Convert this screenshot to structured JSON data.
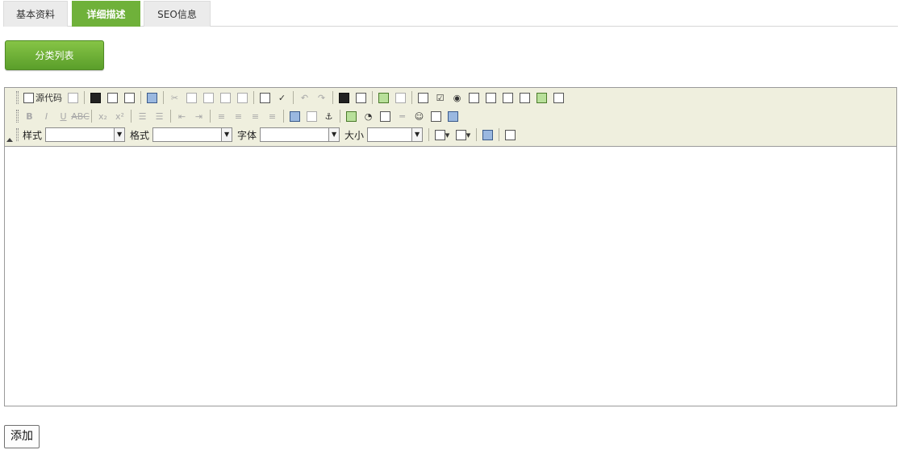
{
  "tabs": [
    {
      "label": "基本资料"
    },
    {
      "label": "详细描述"
    },
    {
      "label": "SEO信息"
    }
  ],
  "category_button": "分类列表",
  "editor": {
    "source_label": "源代码",
    "style_label": "样式",
    "format_label": "格式",
    "font_label": "字体",
    "size_label": "大小",
    "style_value": "",
    "format_value": "",
    "font_value": "",
    "size_value": "",
    "content": ""
  },
  "submit_button": "添加"
}
